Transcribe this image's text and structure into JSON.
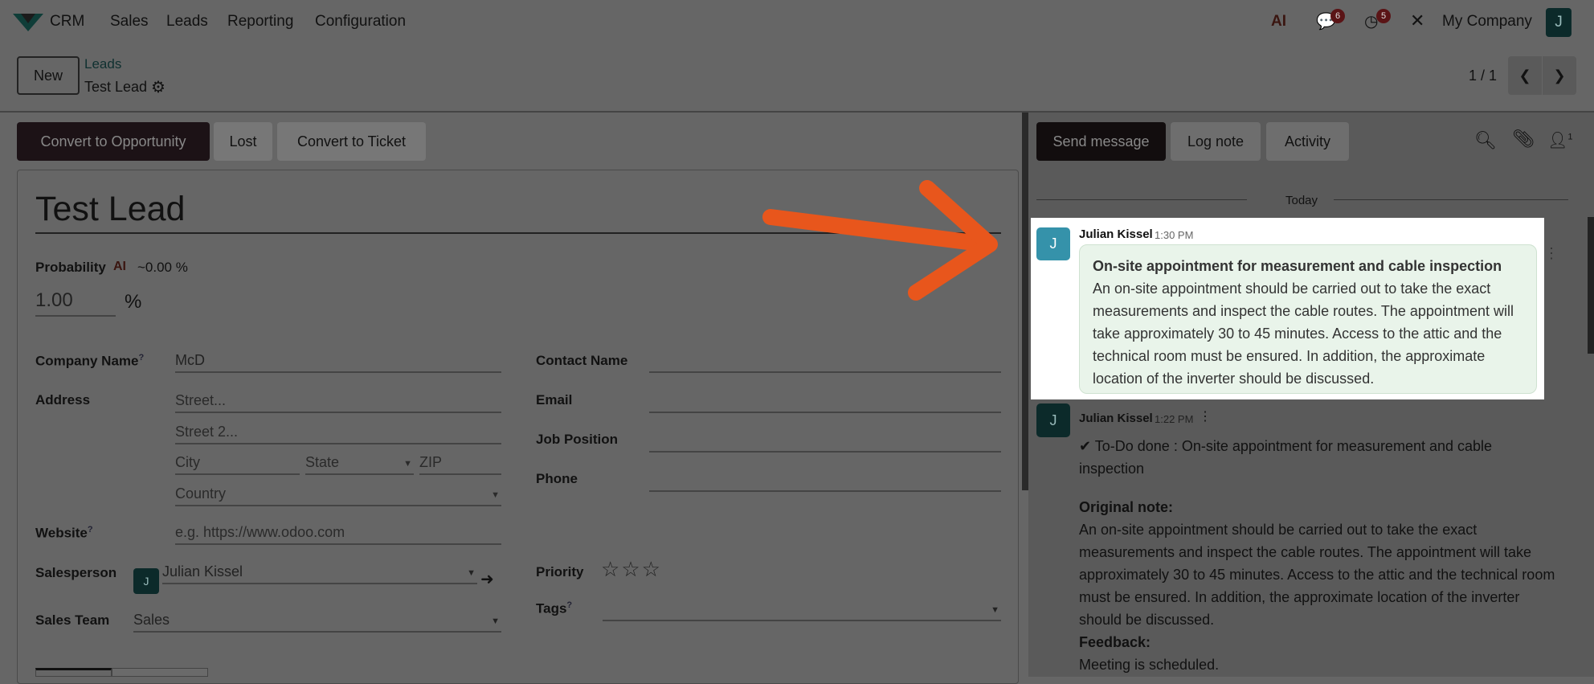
{
  "navbar": {
    "app": "CRM",
    "menus": [
      "Sales",
      "Leads",
      "Reporting",
      "Configuration"
    ],
    "ai_label": "AI",
    "messages_count": "6",
    "activities_count": "5",
    "company": "My Company",
    "user_initial": "J"
  },
  "control": {
    "new_label": "New",
    "breadcrumb_parent": "Leads",
    "breadcrumb_current": "Test Lead",
    "pager": "1 / 1"
  },
  "actions": {
    "convert_opportunity": "Convert to Opportunity",
    "lost": "Lost",
    "convert_ticket": "Convert to Ticket"
  },
  "form": {
    "title": "Test Lead",
    "probability_label": "Probability",
    "probability_ai": "AI",
    "probability_computed": "~0.00 %",
    "probability_value": "1.00",
    "percent": "%",
    "company_name_label": "Company Name",
    "company_name": "McD",
    "address_label": "Address",
    "street_ph": "Street...",
    "street2_ph": "Street 2...",
    "city_ph": "City",
    "state_ph": "State",
    "zip_ph": "ZIP",
    "country_ph": "Country",
    "website_label": "Website",
    "website_ph": "e.g. https://www.odoo.com",
    "salesperson_label": "Salesperson",
    "salesperson": "Julian Kissel",
    "salesperson_initial": "J",
    "sales_team_label": "Sales Team",
    "sales_team": "Sales",
    "contact_name_label": "Contact Name",
    "email_label": "Email",
    "job_position_label": "Job Position",
    "phone_label": "Phone",
    "priority_label": "Priority",
    "tags_label": "Tags",
    "help": "?"
  },
  "chatter": {
    "send_message": "Send message",
    "log_note": "Log note",
    "activity": "Activity",
    "followers_count": "1",
    "date_separator": "Today",
    "messages": [
      {
        "initial": "J",
        "author": "Julian Kissel",
        "time": "1:30 PM",
        "title": "On-site appointment for measurement and cable inspection",
        "body": "An on-site appointment should be carried out to take the exact measurements and inspect the cable routes. The appointment will take approximately 30 to 45 minutes. Access to the attic and the technical room must be ensured. In addition, the approximate location of the inverter should be discussed."
      },
      {
        "initial": "J",
        "author": "Julian Kissel",
        "time": "1:22 PM",
        "done": "✔ To-Do done : On-site appointment for measurement and cable inspection",
        "original_label": "Original note:",
        "body": "An on-site appointment should be carried out to take the exact measurements and inspect the cable routes. The appointment will take approximately 30 to 45 minutes. Access to the attic and the technical room must be ensured. In addition, the approximate location of the inverter should be discussed.",
        "feedback_label": "Feedback:",
        "feedback": "Meeting is scheduled."
      }
    ]
  },
  "colors": {
    "accent_arrow": "#e8561c",
    "highlight_bg": "#ffffff",
    "bubble_bg": "#e9f4ea"
  }
}
